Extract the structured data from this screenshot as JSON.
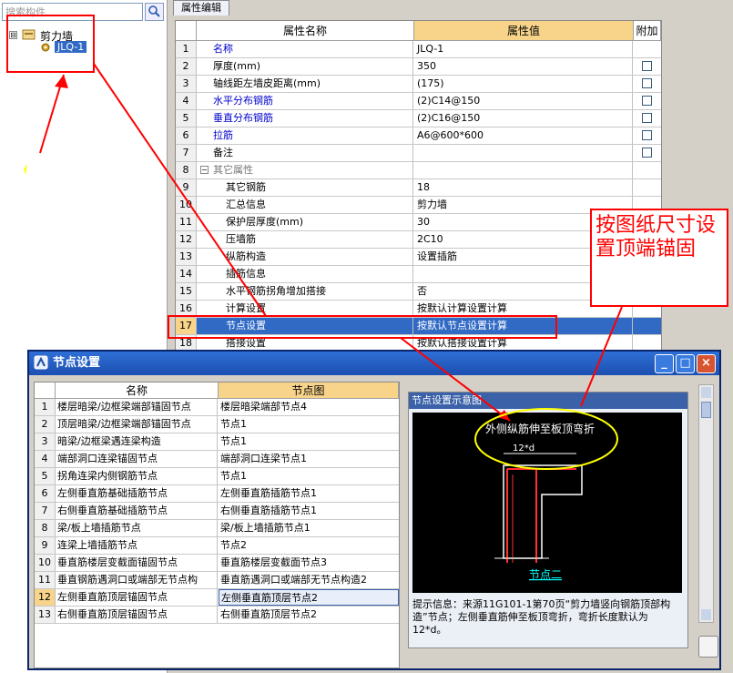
{
  "left": {
    "search_placeholder": "搜索构件",
    "tree_root": "剪力墙",
    "tree_child": "JLQ-1",
    "tree_expander": "⊟"
  },
  "props": {
    "tab": "属性编辑",
    "col_name": "属性名称",
    "col_value": "属性值",
    "col_add": "附加",
    "rows": [
      {
        "num": "1",
        "name": "名称",
        "value": "JLQ-1",
        "blue": true,
        "check": false
      },
      {
        "num": "2",
        "name": "厚度(mm)",
        "value": "350",
        "blue": false,
        "check": true
      },
      {
        "num": "3",
        "name": "轴线距左墙皮距离(mm)",
        "value": "(175)",
        "blue": false,
        "check": true
      },
      {
        "num": "4",
        "name": "水平分布钢筋",
        "value": "(2)C14@150",
        "blue": true,
        "check": true
      },
      {
        "num": "5",
        "name": "垂直分布钢筋",
        "value": "(2)C16@150",
        "blue": true,
        "check": true
      },
      {
        "num": "6",
        "name": "拉筋",
        "value": "A6@600*600",
        "blue": true,
        "check": true
      },
      {
        "num": "7",
        "name": "备注",
        "value": "",
        "blue": false,
        "check": true
      },
      {
        "num": "8",
        "name": "其它属性",
        "value": "",
        "blue": false,
        "check": false
      },
      {
        "num": "9",
        "name": "其它钢筋",
        "value": "18",
        "blue": false,
        "check": false
      },
      {
        "num": "10",
        "name": "汇总信息",
        "value": "剪力墙",
        "blue": false,
        "check": false
      },
      {
        "num": "11",
        "name": "保护层厚度(mm)",
        "value": "30",
        "blue": false,
        "check": false
      },
      {
        "num": "12",
        "name": "压墙筋",
        "value": "2C10",
        "blue": false,
        "check": false
      },
      {
        "num": "13",
        "name": "纵筋构造",
        "value": "设置插筋",
        "blue": false,
        "check": false
      },
      {
        "num": "14",
        "name": "插筋信息",
        "value": "",
        "blue": false,
        "check": false
      },
      {
        "num": "15",
        "name": "水平钢筋拐角增加搭接",
        "value": "否",
        "blue": false,
        "check": false
      },
      {
        "num": "16",
        "name": "计算设置",
        "value": "按默认计算设置计算",
        "blue": false,
        "check": false
      },
      {
        "num": "17",
        "name": "节点设置",
        "value": "按默认节点设置计算",
        "blue": false,
        "check": false
      },
      {
        "num": "18",
        "name": "搭接设置",
        "value": "按默认搭接设置计算",
        "blue": false,
        "check": false
      }
    ],
    "group_toggle": "−"
  },
  "dialog": {
    "title": "节点设置",
    "col_name": "名称",
    "col_node": "节点图",
    "rows": [
      {
        "num": "1",
        "name": "楼层暗梁/边框梁端部锚固节点",
        "node": "楼层暗梁端部节点4"
      },
      {
        "num": "2",
        "name": "顶层暗梁/边框梁端部锚固节点",
        "node": "节点1"
      },
      {
        "num": "3",
        "name": "暗梁/边框梁遇连梁构造",
        "node": "节点1"
      },
      {
        "num": "4",
        "name": "端部洞口连梁锚固节点",
        "node": "端部洞口连梁节点1"
      },
      {
        "num": "5",
        "name": "拐角连梁内侧钢筋节点",
        "node": "节点1"
      },
      {
        "num": "6",
        "name": "左侧垂直筋基础插筋节点",
        "node": "左侧垂直筋插筋节点1"
      },
      {
        "num": "7",
        "name": "右侧垂直筋基础插筋节点",
        "node": "右侧垂直筋插筋节点1"
      },
      {
        "num": "8",
        "name": "梁/板上墙插筋节点",
        "node": "梁/板上墙插筋节点1"
      },
      {
        "num": "9",
        "name": "连梁上墙插筋节点",
        "node": "节点2"
      },
      {
        "num": "10",
        "name": "垂直筋楼层变截面锚固节点",
        "node": "垂直筋楼层变截面节点3"
      },
      {
        "num": "11",
        "name": "垂直钢筋遇洞口或端部无节点构",
        "node": "垂直筋遇洞口或端部无节点构造2"
      },
      {
        "num": "12",
        "name": "左侧垂直筋顶层锚固节点",
        "node": "左侧垂直筋顶层节点2"
      },
      {
        "num": "13",
        "name": "右侧垂直筋顶层锚固节点",
        "node": "右侧垂直筋顶层节点2"
      }
    ],
    "preview_title": "节点设置示意图",
    "diagram_caption": "外侧纵筋伸至板顶弯折",
    "diagram_dim": "12*d",
    "diagram_node": "节点二",
    "tip_label": "提示信息：",
    "tip_text": "来源11G101-1第70页“剪力墙竖向钢筋顶部构造”节点；左侧垂直筋伸至板顶弯折，弯折长度默认为12*d。",
    "btn_min": "_",
    "btn_max": "□",
    "btn_close": "×"
  },
  "annotation": {
    "text": "按图纸尺寸设置顶端锚固"
  },
  "colors": {
    "highlight": "#316ac5",
    "annotation_red": "#ff0000",
    "ellipse_yellow": "#ffff00"
  }
}
